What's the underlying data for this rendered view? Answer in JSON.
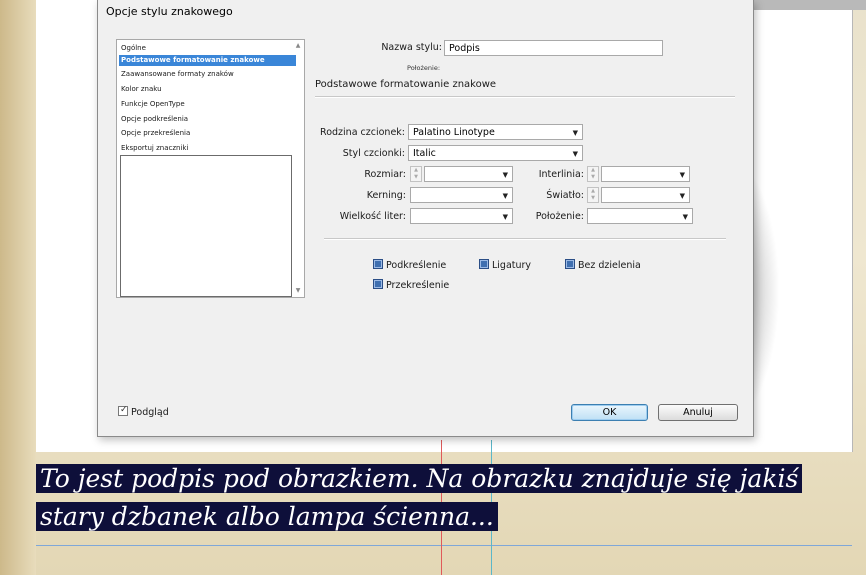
{
  "dialog": {
    "title": "Opcje stylu znakowego",
    "categories": [
      "Ogólne",
      "Podstawowe formatowanie znakowe",
      "Zaawansowane formaty znaków",
      "Kolor znaku",
      "Funkcje OpenType",
      "Opcje podkreślenia",
      "Opcje przekreślenia",
      "Eksportuj znaczniki"
    ],
    "selected_category": "Podstawowe formatowanie znakowe",
    "style_name_label": "Nazwa stylu:",
    "style_name_value": "Podpis",
    "location_label": "Położenie:",
    "section_title": "Podstawowe formatowanie znakowe",
    "font_family_label": "Rodzina czcionek:",
    "font_family_value": "Palatino Linotype",
    "font_style_label": "Styl czcionki:",
    "font_style_value": "Italic",
    "size_label": "Rozmiar:",
    "size_value": "",
    "leading_label": "Interlinia:",
    "leading_value": "",
    "kerning_label": "Kerning:",
    "kerning_value": "",
    "tracking_label": "Światło:",
    "tracking_value": "",
    "case_label": "Wielkość liter:",
    "case_value": "",
    "position_label": "Położenie:",
    "position_value": "",
    "checkboxes": {
      "underline": "Podkreślenie",
      "ligatures": "Ligatury",
      "no_break": "Bez dzielenia",
      "strikethrough": "Przekreślenie"
    },
    "preview_label": "Podgląd",
    "ok_label": "OK",
    "cancel_label": "Anuluj"
  },
  "caption": {
    "text": "To jest podpis pod obrazkiem. Na obrazku znajduje się jakiś stary dzbanek albo lampa ścienna..."
  },
  "colors": {
    "selection": "#3a86d8",
    "caption_bg": "#0e0f3a",
    "checkbox_fill": "#3f6fb0"
  }
}
